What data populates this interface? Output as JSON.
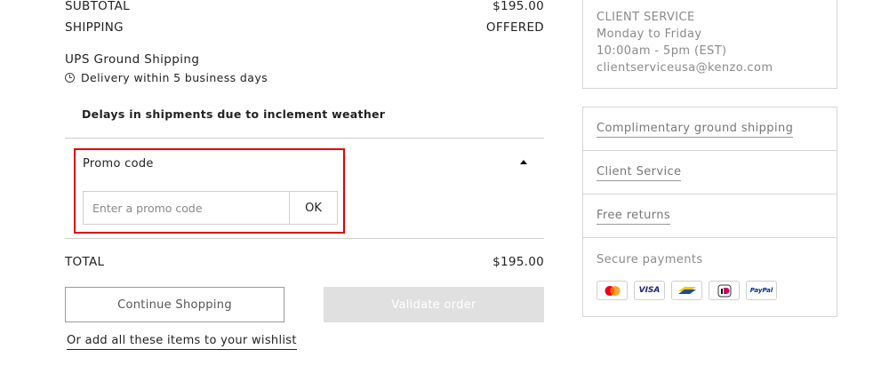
{
  "summary": {
    "subtotal_label": "SUBTOTAL",
    "subtotal_value": "$195.00",
    "shipping_label": "SHIPPING",
    "shipping_value": "OFFERED",
    "shipping_method": "UPS Ground Shipping",
    "delivery_text": "Delivery within 5 business days",
    "notice": "Delays in shipments due to inclement weather",
    "total_label": "TOTAL",
    "total_value": "$195.00"
  },
  "promo": {
    "label": "Promo code",
    "placeholder": "Enter a promo code",
    "value": "",
    "button_label": "OK",
    "expanded": true
  },
  "actions": {
    "continue_label": "Continue Shopping",
    "validate_label": "Validate order",
    "wishlist_label": "Or add all these items to your wishlist"
  },
  "client_service": {
    "title": "CLIENT SERVICE",
    "hours_days": "Monday to Friday",
    "hours_time": "10:00am - 5pm (EST)",
    "email": "clientserviceusa@kenzo.com"
  },
  "info_links": [
    {
      "label": "Complimentary ground shipping"
    },
    {
      "label": "Client Service"
    },
    {
      "label": "Free returns"
    }
  ],
  "payments": {
    "label": "Secure payments",
    "methods": [
      "mastercard-icon",
      "visa-icon",
      "bancontact-icon",
      "ideal-icon",
      "paypal-icon"
    ],
    "visa_text": "VISA",
    "paypal_text": "PayPal"
  },
  "colors": {
    "highlight_border": "#e00000",
    "disabled_button": "#e0e0e0",
    "muted_text": "#8a8a8a"
  }
}
